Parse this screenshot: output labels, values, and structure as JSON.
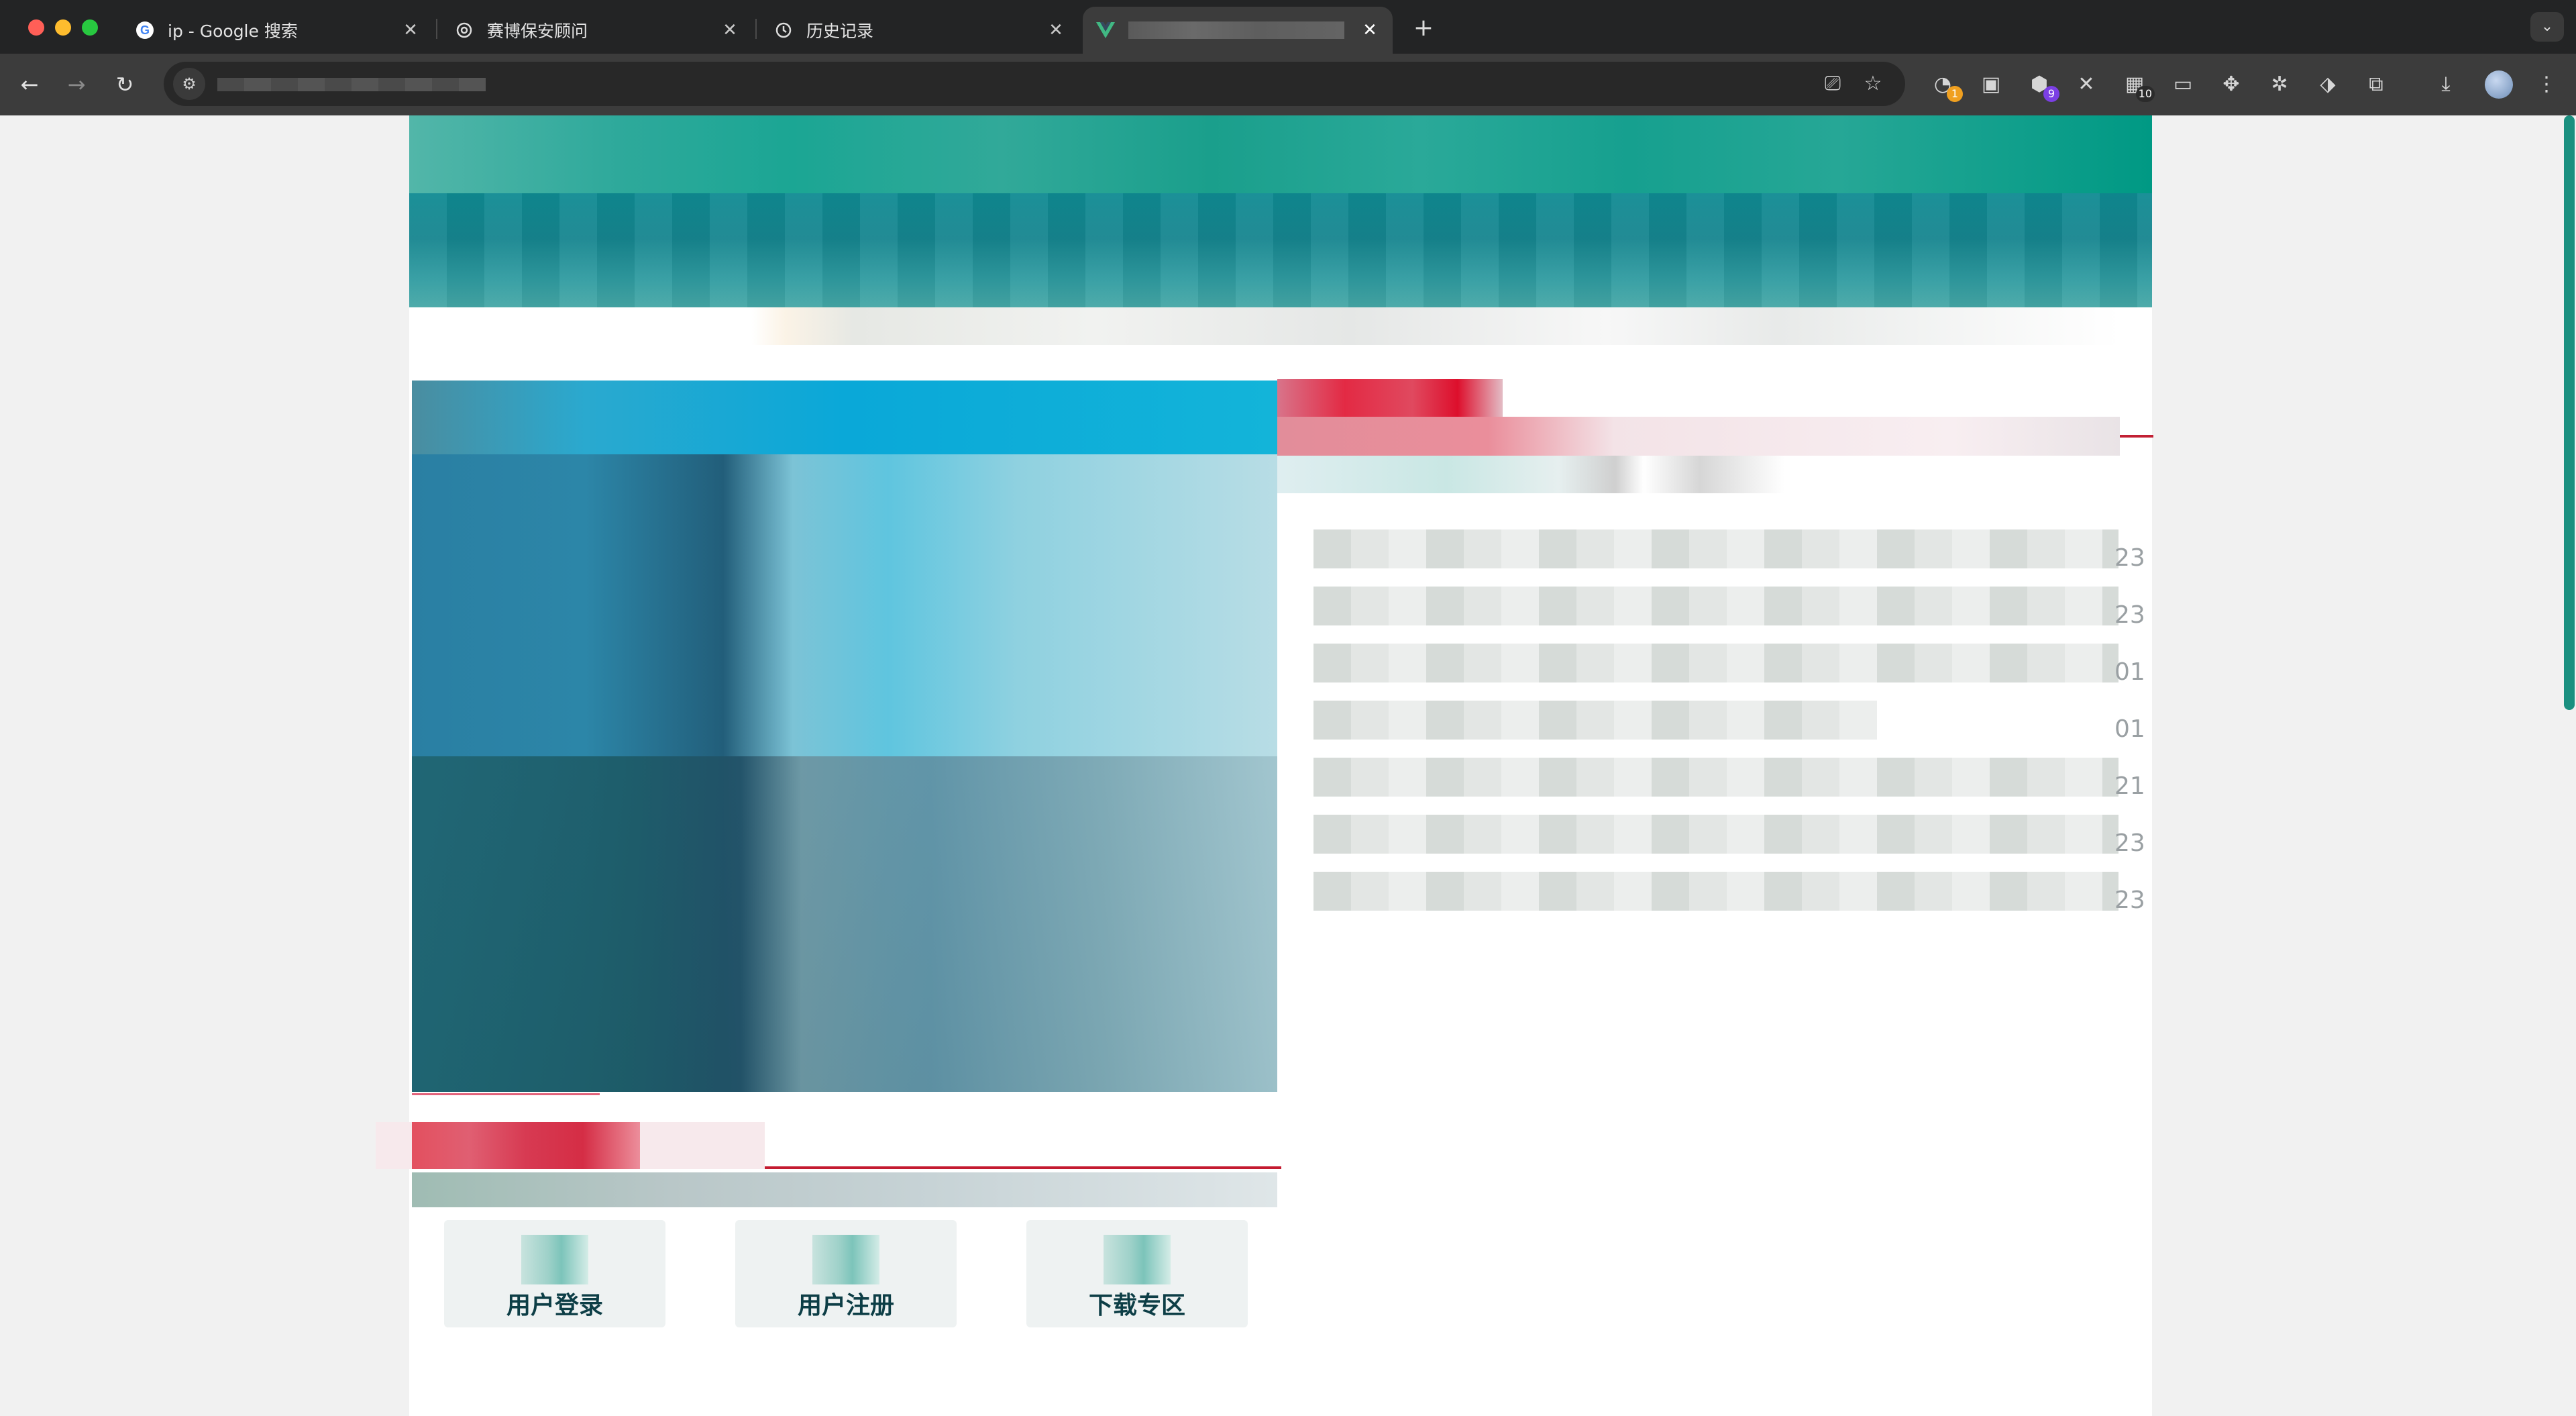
{
  "browser": {
    "tabs": [
      {
        "title": "ip - Google 搜索",
        "favicon": "google-icon",
        "active": false
      },
      {
        "title": "赛博保安顾问",
        "favicon": "openai-icon",
        "active": false
      },
      {
        "title": "历史记录",
        "favicon": "history-icon",
        "active": false
      },
      {
        "title": "",
        "favicon": "vue-icon",
        "active": true
      }
    ],
    "toolbar": {
      "url": "",
      "extensions": [
        {
          "name": "extension-icon-1",
          "badge": "1",
          "badge_color": "#f0a020"
        },
        {
          "name": "extension-icon-2",
          "badge": ""
        },
        {
          "name": "extension-icon-3",
          "badge": "9",
          "badge_color": "#7b3fe4"
        },
        {
          "name": "extension-icon-4",
          "badge": ""
        },
        {
          "name": "extension-icon-5",
          "badge": "10",
          "badge_color": "#2b2b2b"
        },
        {
          "name": "extension-icon-6",
          "badge": ""
        },
        {
          "name": "extension-icon-7",
          "badge": ""
        },
        {
          "name": "extension-icon-8",
          "badge": ""
        },
        {
          "name": "extension-icon-9",
          "badge": ""
        }
      ]
    }
  },
  "page": {
    "news_dates": [
      "23",
      "23",
      "01",
      "01",
      "21",
      "23",
      "23"
    ],
    "quick_links": [
      {
        "label": "用户登录",
        "icon": "login-icon"
      },
      {
        "label": "用户注册",
        "icon": "register-icon"
      },
      {
        "label": "下载专区",
        "icon": "download-icon"
      }
    ]
  },
  "colors": {
    "brand_teal": "#1ba694",
    "accent_red": "#dd0f2c",
    "scrollbar": "#1b9080"
  }
}
